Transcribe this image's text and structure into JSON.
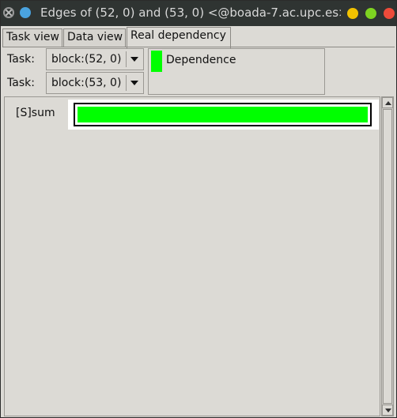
{
  "window": {
    "title": "Edges of (52, 0) and (53, 0) <@boada-7.ac.upc.es>"
  },
  "tabs": [
    {
      "label": "Task view",
      "active": false
    },
    {
      "label": "Data view",
      "active": false
    },
    {
      "label": "Real dependency",
      "active": true
    }
  ],
  "tasks": [
    {
      "label": "Task:",
      "value": "block:(52, 0)"
    },
    {
      "label": "Task:",
      "value": "block:(53, 0)"
    }
  ],
  "legend": {
    "items": [
      {
        "label": "Dependence",
        "color": "#00ff00"
      }
    ]
  },
  "dependencies": [
    {
      "label": "[S]sum",
      "color": "#00ff00"
    }
  ],
  "colors": {
    "titlebar": "#2f3432",
    "window_bg": "#dcdad5",
    "dependence": "#00ff00"
  },
  "icons": {
    "title_left": [
      "close-icon",
      "app-icon"
    ],
    "title_right": [
      "minimize-icon",
      "maximize-icon",
      "close-icon"
    ]
  }
}
